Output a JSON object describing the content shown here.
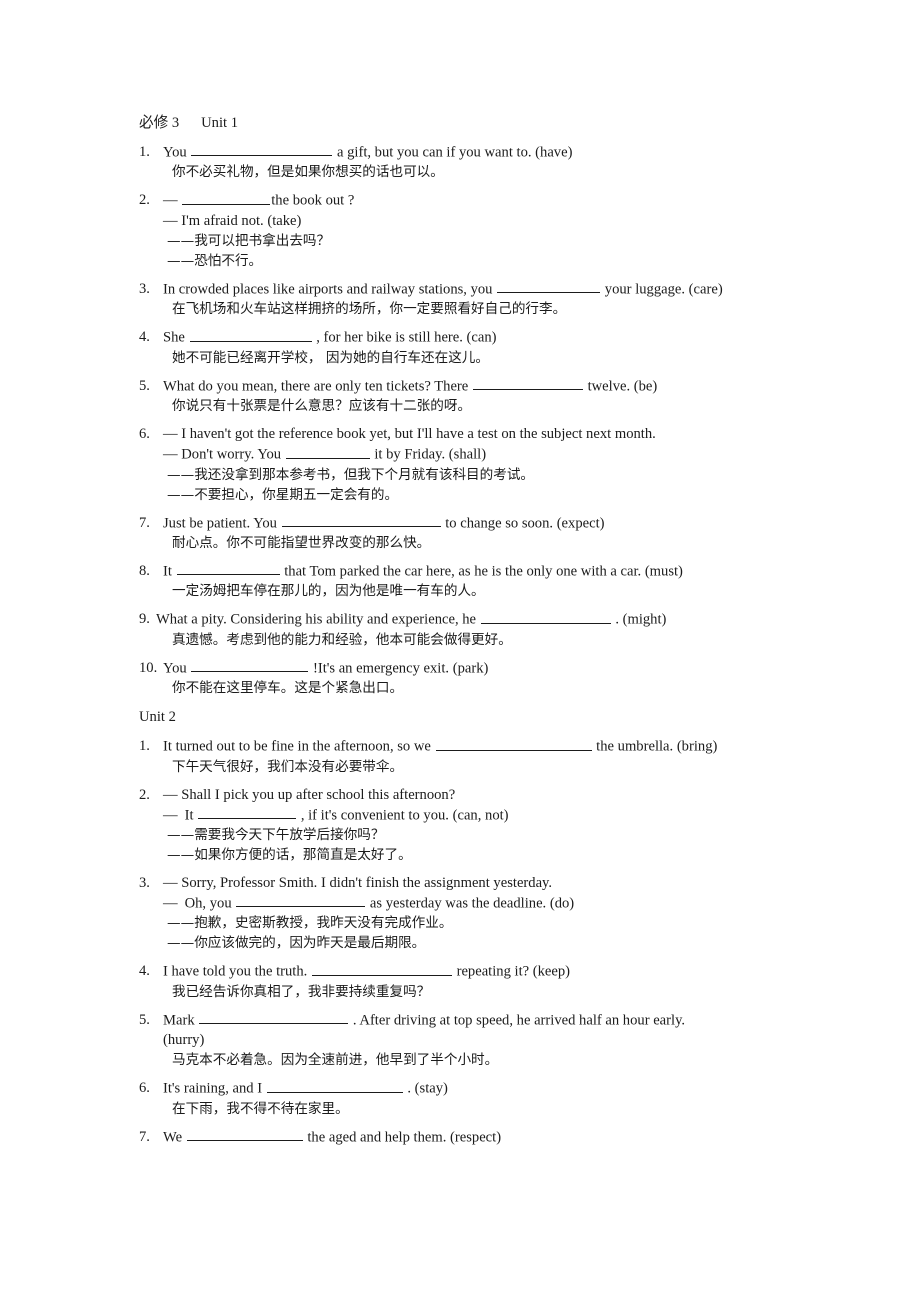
{
  "document": {
    "book_title": "必修 3",
    "unit1_label": "Unit 1",
    "unit2_label": "Unit 2",
    "em_dash": "—",
    "zh_dash": "——"
  },
  "unit1": {
    "items": [
      {
        "num": "1.",
        "en_pre": "You",
        "blank_w": 141,
        "en_post": "a gift, but you can if you want to. (have)",
        "zh": "你不必买礼物，但是如果你想买的话也可以。"
      },
      {
        "num": "2.",
        "dlg1_pre": "—",
        "dlg1_blank_w": 88,
        "dlg1_post": "the book out ?",
        "dlg2": "— I'm afraid not. (take)",
        "zh1": "——我可以把书拿出去吗？",
        "zh2": "——恐怕不行。"
      },
      {
        "num": "3.",
        "en_pre": "In crowded places like airports and railway stations, you",
        "blank_w": 103,
        "en_post": "your luggage. (care)",
        "zh": "在飞机场和火车站这样拥挤的场所，你一定要照看好自己的行李。"
      },
      {
        "num": "4.",
        "en_pre": "She",
        "blank_w": 122,
        "en_post": ", for her bike is still here. (can)",
        "zh": "她不可能已经离开学校， 因为她的自行车还在这儿。"
      },
      {
        "num": "5.",
        "en_pre": "What do you mean, there are only ten tickets? There",
        "blank_w": 110,
        "en_post": "twelve. (be)",
        "zh": "你说只有十张票是什么意思？应该有十二张的呀。"
      },
      {
        "num": "6.",
        "dlg1": "— I haven't got the reference book yet, but I'll have a test on the subject next month.",
        "dlg2_pre": "— Don't worry. You",
        "dlg2_blank_w": 84,
        "dlg2_post": "it by Friday. (shall)",
        "zh1": "——我还没拿到那本参考书，但我下个月就有该科目的考试。",
        "zh2": "——不要担心，你星期五一定会有的。"
      },
      {
        "num": "7.",
        "en_pre": "Just be patient. You",
        "blank_w": 159,
        "en_post": "to change so soon. (expect)",
        "zh": "耐心点。你不可能指望世界改变的那么快。"
      },
      {
        "num": "8.",
        "en_pre": "It",
        "blank_w": 103,
        "en_post": "that Tom parked the car here, as he is the only one with a car. (must)",
        "zh": "一定汤姆把车停在那儿的，因为他是唯一有车的人。"
      },
      {
        "num": "9.",
        "tight": true,
        "en_pre": "What a pity. Considering his ability and experience, he",
        "blank_w": 130,
        "en_post": ". (might)",
        "zh": "真遗憾。考虑到他的能力和经验，他本可能会做得更好。"
      },
      {
        "num": "10.",
        "en_pre": "You",
        "blank_w": 117,
        "en_post": "!It's an emergency exit. (park)",
        "zh": "你不能在这里停车。这是个紧急出口。"
      }
    ]
  },
  "unit2": {
    "items": [
      {
        "num": "1.",
        "en_pre": "It turned out to be fine in the afternoon, so we",
        "blank_w": 156,
        "en_post": "the umbrella. (bring)",
        "zh": "下午天气很好，我们本没有必要带伞。"
      },
      {
        "num": "2.",
        "dlg1": "— Shall I pick you up after school this afternoon?",
        "dlg2_dash": "—",
        "dlg2_pre": "It",
        "dlg2_blank_w": 98,
        "dlg2_post": ", if it's convenient to you. (can, not)",
        "zh1": "——需要我今天下午放学后接你吗？",
        "zh2": "——如果你方便的话，那简直是太好了。"
      },
      {
        "num": "3.",
        "dlg1": "— Sorry, Professor Smith. I didn't finish the assignment yesterday.",
        "dlg2_dash": "—",
        "dlg2_pre": "Oh, you",
        "dlg2_blank_w": 129,
        "dlg2_post": "as yesterday was the deadline. (do)",
        "zh1": "——抱歉，史密斯教授，我昨天没有完成作业。",
        "zh2": "——你应该做完的，因为昨天是最后期限。"
      },
      {
        "num": "4.",
        "en_pre": "I have told you the truth.",
        "blank_w": 140,
        "en_post": "repeating it? (keep)",
        "zh": "我已经告诉你真相了，我非要持续重复吗？"
      },
      {
        "num": "5.",
        "justify": true,
        "en_pre": "Mark",
        "blank_w": 149,
        "en_post": ". After driving at top speed, he arrived half an hour early.",
        "en_cont": "(hurry)",
        "zh": "马克本不必着急。因为全速前进，他早到了半个小时。"
      },
      {
        "num": "6.",
        "en_pre": "It's raining, and I",
        "blank_w": 136,
        "en_post": ". (stay)",
        "zh": "在下雨，我不得不待在家里。"
      },
      {
        "num": "7.",
        "en_pre": "We",
        "blank_w": 116,
        "en_post": "the aged and help them. (respect)"
      }
    ]
  }
}
